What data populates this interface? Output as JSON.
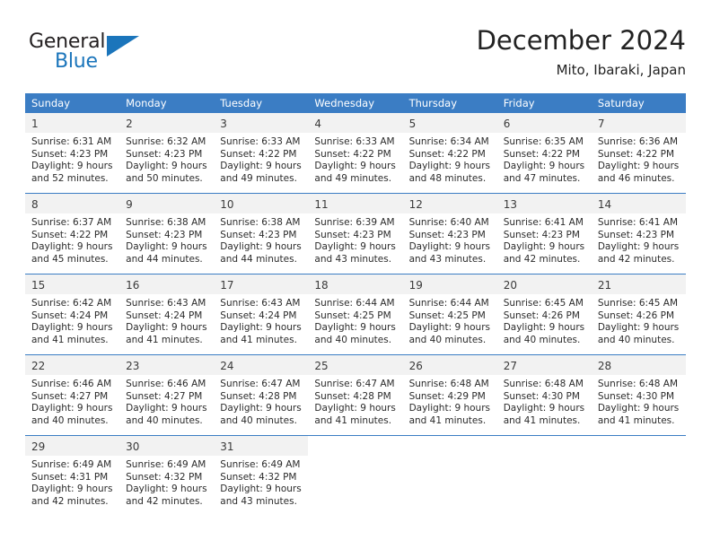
{
  "brand": {
    "name_part1": "General",
    "name_part2": "Blue",
    "triangle_color": "#1b75bb"
  },
  "header": {
    "title": "December 2024",
    "subtitle": "Mito, Ibaraki, Japan"
  },
  "theme": {
    "header_blue": "#3b7dc4",
    "daynum_bg": "#f2f2f2",
    "text": "#222222"
  },
  "weekdays": [
    "Sunday",
    "Monday",
    "Tuesday",
    "Wednesday",
    "Thursday",
    "Friday",
    "Saturday"
  ],
  "weeks": [
    [
      {
        "day": "1",
        "sunrise": "Sunrise: 6:31 AM",
        "sunset": "Sunset: 4:23 PM",
        "daylight1": "Daylight: 9 hours",
        "daylight2": "and 52 minutes."
      },
      {
        "day": "2",
        "sunrise": "Sunrise: 6:32 AM",
        "sunset": "Sunset: 4:23 PM",
        "daylight1": "Daylight: 9 hours",
        "daylight2": "and 50 minutes."
      },
      {
        "day": "3",
        "sunrise": "Sunrise: 6:33 AM",
        "sunset": "Sunset: 4:22 PM",
        "daylight1": "Daylight: 9 hours",
        "daylight2": "and 49 minutes."
      },
      {
        "day": "4",
        "sunrise": "Sunrise: 6:33 AM",
        "sunset": "Sunset: 4:22 PM",
        "daylight1": "Daylight: 9 hours",
        "daylight2": "and 49 minutes."
      },
      {
        "day": "5",
        "sunrise": "Sunrise: 6:34 AM",
        "sunset": "Sunset: 4:22 PM",
        "daylight1": "Daylight: 9 hours",
        "daylight2": "and 48 minutes."
      },
      {
        "day": "6",
        "sunrise": "Sunrise: 6:35 AM",
        "sunset": "Sunset: 4:22 PM",
        "daylight1": "Daylight: 9 hours",
        "daylight2": "and 47 minutes."
      },
      {
        "day": "7",
        "sunrise": "Sunrise: 6:36 AM",
        "sunset": "Sunset: 4:22 PM",
        "daylight1": "Daylight: 9 hours",
        "daylight2": "and 46 minutes."
      }
    ],
    [
      {
        "day": "8",
        "sunrise": "Sunrise: 6:37 AM",
        "sunset": "Sunset: 4:22 PM",
        "daylight1": "Daylight: 9 hours",
        "daylight2": "and 45 minutes."
      },
      {
        "day": "9",
        "sunrise": "Sunrise: 6:38 AM",
        "sunset": "Sunset: 4:23 PM",
        "daylight1": "Daylight: 9 hours",
        "daylight2": "and 44 minutes."
      },
      {
        "day": "10",
        "sunrise": "Sunrise: 6:38 AM",
        "sunset": "Sunset: 4:23 PM",
        "daylight1": "Daylight: 9 hours",
        "daylight2": "and 44 minutes."
      },
      {
        "day": "11",
        "sunrise": "Sunrise: 6:39 AM",
        "sunset": "Sunset: 4:23 PM",
        "daylight1": "Daylight: 9 hours",
        "daylight2": "and 43 minutes."
      },
      {
        "day": "12",
        "sunrise": "Sunrise: 6:40 AM",
        "sunset": "Sunset: 4:23 PM",
        "daylight1": "Daylight: 9 hours",
        "daylight2": "and 43 minutes."
      },
      {
        "day": "13",
        "sunrise": "Sunrise: 6:41 AM",
        "sunset": "Sunset: 4:23 PM",
        "daylight1": "Daylight: 9 hours",
        "daylight2": "and 42 minutes."
      },
      {
        "day": "14",
        "sunrise": "Sunrise: 6:41 AM",
        "sunset": "Sunset: 4:23 PM",
        "daylight1": "Daylight: 9 hours",
        "daylight2": "and 42 minutes."
      }
    ],
    [
      {
        "day": "15",
        "sunrise": "Sunrise: 6:42 AM",
        "sunset": "Sunset: 4:24 PM",
        "daylight1": "Daylight: 9 hours",
        "daylight2": "and 41 minutes."
      },
      {
        "day": "16",
        "sunrise": "Sunrise: 6:43 AM",
        "sunset": "Sunset: 4:24 PM",
        "daylight1": "Daylight: 9 hours",
        "daylight2": "and 41 minutes."
      },
      {
        "day": "17",
        "sunrise": "Sunrise: 6:43 AM",
        "sunset": "Sunset: 4:24 PM",
        "daylight1": "Daylight: 9 hours",
        "daylight2": "and 41 minutes."
      },
      {
        "day": "18",
        "sunrise": "Sunrise: 6:44 AM",
        "sunset": "Sunset: 4:25 PM",
        "daylight1": "Daylight: 9 hours",
        "daylight2": "and 40 minutes."
      },
      {
        "day": "19",
        "sunrise": "Sunrise: 6:44 AM",
        "sunset": "Sunset: 4:25 PM",
        "daylight1": "Daylight: 9 hours",
        "daylight2": "and 40 minutes."
      },
      {
        "day": "20",
        "sunrise": "Sunrise: 6:45 AM",
        "sunset": "Sunset: 4:26 PM",
        "daylight1": "Daylight: 9 hours",
        "daylight2": "and 40 minutes."
      },
      {
        "day": "21",
        "sunrise": "Sunrise: 6:45 AM",
        "sunset": "Sunset: 4:26 PM",
        "daylight1": "Daylight: 9 hours",
        "daylight2": "and 40 minutes."
      }
    ],
    [
      {
        "day": "22",
        "sunrise": "Sunrise: 6:46 AM",
        "sunset": "Sunset: 4:27 PM",
        "daylight1": "Daylight: 9 hours",
        "daylight2": "and 40 minutes."
      },
      {
        "day": "23",
        "sunrise": "Sunrise: 6:46 AM",
        "sunset": "Sunset: 4:27 PM",
        "daylight1": "Daylight: 9 hours",
        "daylight2": "and 40 minutes."
      },
      {
        "day": "24",
        "sunrise": "Sunrise: 6:47 AM",
        "sunset": "Sunset: 4:28 PM",
        "daylight1": "Daylight: 9 hours",
        "daylight2": "and 40 minutes."
      },
      {
        "day": "25",
        "sunrise": "Sunrise: 6:47 AM",
        "sunset": "Sunset: 4:28 PM",
        "daylight1": "Daylight: 9 hours",
        "daylight2": "and 41 minutes."
      },
      {
        "day": "26",
        "sunrise": "Sunrise: 6:48 AM",
        "sunset": "Sunset: 4:29 PM",
        "daylight1": "Daylight: 9 hours",
        "daylight2": "and 41 minutes."
      },
      {
        "day": "27",
        "sunrise": "Sunrise: 6:48 AM",
        "sunset": "Sunset: 4:30 PM",
        "daylight1": "Daylight: 9 hours",
        "daylight2": "and 41 minutes."
      },
      {
        "day": "28",
        "sunrise": "Sunrise: 6:48 AM",
        "sunset": "Sunset: 4:30 PM",
        "daylight1": "Daylight: 9 hours",
        "daylight2": "and 41 minutes."
      }
    ],
    [
      {
        "day": "29",
        "sunrise": "Sunrise: 6:49 AM",
        "sunset": "Sunset: 4:31 PM",
        "daylight1": "Daylight: 9 hours",
        "daylight2": "and 42 minutes."
      },
      {
        "day": "30",
        "sunrise": "Sunrise: 6:49 AM",
        "sunset": "Sunset: 4:32 PM",
        "daylight1": "Daylight: 9 hours",
        "daylight2": "and 42 minutes."
      },
      {
        "day": "31",
        "sunrise": "Sunrise: 6:49 AM",
        "sunset": "Sunset: 4:32 PM",
        "daylight1": "Daylight: 9 hours",
        "daylight2": "and 43 minutes."
      },
      {
        "day": "",
        "sunrise": "",
        "sunset": "",
        "daylight1": "",
        "daylight2": ""
      },
      {
        "day": "",
        "sunrise": "",
        "sunset": "",
        "daylight1": "",
        "daylight2": ""
      },
      {
        "day": "",
        "sunrise": "",
        "sunset": "",
        "daylight1": "",
        "daylight2": ""
      },
      {
        "day": "",
        "sunrise": "",
        "sunset": "",
        "daylight1": "",
        "daylight2": ""
      }
    ]
  ]
}
